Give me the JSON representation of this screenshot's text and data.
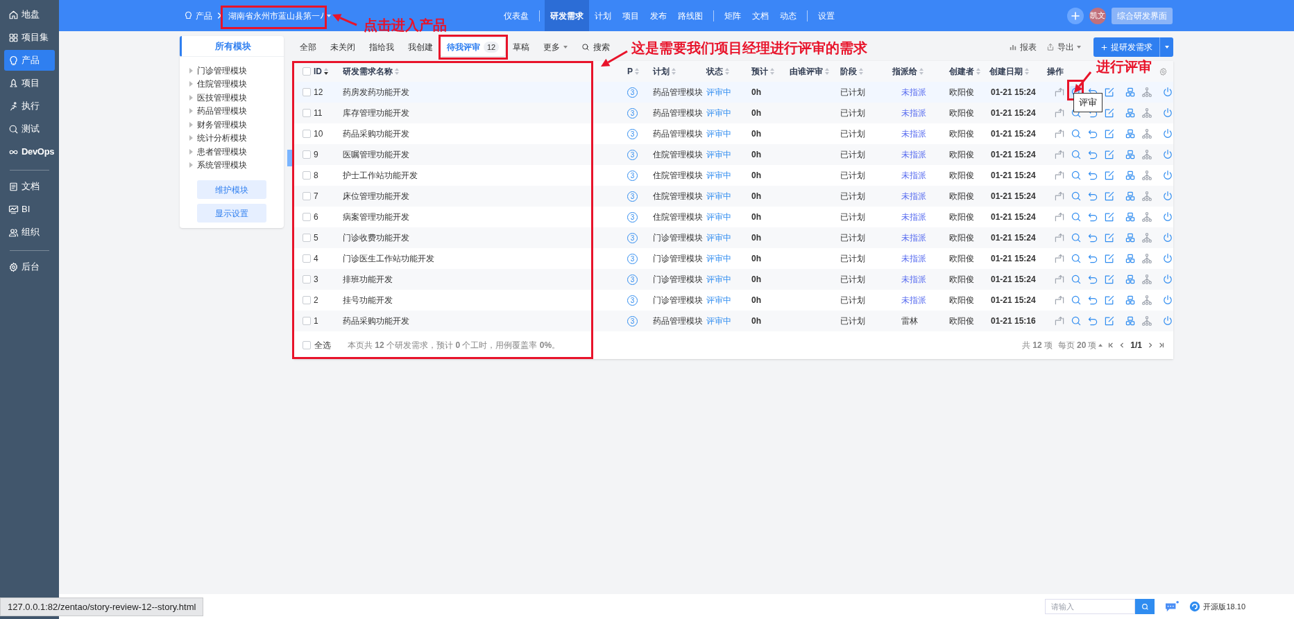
{
  "sidebar": {
    "groups": [
      [
        {
          "label": "地盘",
          "selected": false
        },
        {
          "label": "项目集",
          "selected": false
        },
        {
          "label": "产品",
          "selected": true
        },
        {
          "label": "项目",
          "selected": false
        },
        {
          "label": "执行",
          "selected": false
        },
        {
          "label": "测试",
          "selected": false
        },
        {
          "label": "DevOps",
          "selected": false
        }
      ],
      [
        {
          "label": "文档",
          "selected": false
        },
        {
          "label": "BI",
          "selected": false
        },
        {
          "label": "组织",
          "selected": false
        }
      ],
      [
        {
          "label": "后台",
          "selected": false
        }
      ]
    ]
  },
  "topbar": {
    "breadcrumb": {
      "section": "产品",
      "product": "湖南省永州市蓝山县第一ﾉ"
    },
    "nav_groups": [
      [
        {
          "label": "仪表盘",
          "selected": false
        }
      ],
      [
        {
          "label": "研发需求",
          "selected": true
        },
        {
          "label": "计划",
          "selected": false
        },
        {
          "label": "项目",
          "selected": false
        },
        {
          "label": "发布",
          "selected": false
        },
        {
          "label": "路线图",
          "selected": false
        }
      ],
      [
        {
          "label": "矩阵",
          "selected": false
        },
        {
          "label": "文档",
          "selected": false
        },
        {
          "label": "动态",
          "selected": false
        }
      ],
      [
        {
          "label": "设置",
          "selected": false
        }
      ]
    ],
    "avatar": "凯文",
    "switch_button": "综合研发界面"
  },
  "module_panel": {
    "title": "所有模块",
    "modules": [
      "门诊管理模块",
      "住院管理模块",
      "医技管理模块",
      "药品管理模块",
      "财务管理模块",
      "统计分析模块",
      "患者管理模块",
      "系统管理模块"
    ],
    "buttons": [
      "维护模块",
      "显示设置"
    ]
  },
  "tabs": [
    {
      "kind": "tab",
      "label": "全部",
      "selected": false
    },
    {
      "kind": "tab",
      "label": "未关闭",
      "selected": false
    },
    {
      "kind": "tab",
      "label": "指给我",
      "selected": false
    },
    {
      "kind": "tab",
      "label": "我创建",
      "selected": false
    },
    {
      "kind": "tab",
      "label": "待我评审",
      "count": "12",
      "selected": true
    },
    {
      "kind": "tab",
      "label": "草稿",
      "selected": false
    },
    {
      "kind": "dropdown",
      "label": "更多",
      "selected": false
    },
    {
      "kind": "search",
      "label": "搜索",
      "selected": false
    }
  ],
  "toolbar": {
    "report": "报表",
    "export": "导出",
    "create": "提研发需求"
  },
  "table": {
    "columns": [
      "ID",
      "研发需求名称",
      "P",
      "计划",
      "状态",
      "预计",
      "由谁评审",
      "阶段",
      "指派给",
      "创建者",
      "创建日期",
      "操作"
    ],
    "rows": [
      {
        "id": "12",
        "name": "药房发药功能开发",
        "p": "3",
        "plan": "药品管理模块",
        "status": "评审中",
        "estimate": "0h",
        "stage": "已计划",
        "assigned": "未指派",
        "unassigned": true,
        "creator": "欧阳俊",
        "date": "01-21 15:24",
        "checked": false,
        "hovered": true
      },
      {
        "id": "11",
        "name": "库存管理功能开发",
        "p": "3",
        "plan": "药品管理模块",
        "status": "评审中",
        "estimate": "0h",
        "stage": "已计划",
        "assigned": "未指派",
        "unassigned": true,
        "creator": "欧阳俊",
        "date": "01-21 15:24",
        "checked": false,
        "hovered": false
      },
      {
        "id": "10",
        "name": "药品采购功能开发",
        "p": "3",
        "plan": "药品管理模块",
        "status": "评审中",
        "estimate": "0h",
        "stage": "已计划",
        "assigned": "未指派",
        "unassigned": true,
        "creator": "欧阳俊",
        "date": "01-21 15:24",
        "checked": false,
        "hovered": false
      },
      {
        "id": "9",
        "name": "医嘱管理功能开发",
        "p": "3",
        "plan": "住院管理模块",
        "status": "评审中",
        "estimate": "0h",
        "stage": "已计划",
        "assigned": "未指派",
        "unassigned": true,
        "creator": "欧阳俊",
        "date": "01-21 15:24",
        "checked": false,
        "hovered": false
      },
      {
        "id": "8",
        "name": "护士工作站功能开发",
        "p": "3",
        "plan": "住院管理模块",
        "status": "评审中",
        "estimate": "0h",
        "stage": "已计划",
        "assigned": "未指派",
        "unassigned": true,
        "creator": "欧阳俊",
        "date": "01-21 15:24",
        "checked": false,
        "hovered": false
      },
      {
        "id": "7",
        "name": "床位管理功能开发",
        "p": "3",
        "plan": "住院管理模块",
        "status": "评审中",
        "estimate": "0h",
        "stage": "已计划",
        "assigned": "未指派",
        "unassigned": true,
        "creator": "欧阳俊",
        "date": "01-21 15:24",
        "checked": false,
        "hovered": false
      },
      {
        "id": "6",
        "name": "病案管理功能开发",
        "p": "3",
        "plan": "住院管理模块",
        "status": "评审中",
        "estimate": "0h",
        "stage": "已计划",
        "assigned": "未指派",
        "unassigned": true,
        "creator": "欧阳俊",
        "date": "01-21 15:24",
        "checked": false,
        "hovered": false
      },
      {
        "id": "5",
        "name": "门诊收费功能开发",
        "p": "3",
        "plan": "门诊管理模块",
        "status": "评审中",
        "estimate": "0h",
        "stage": "已计划",
        "assigned": "未指派",
        "unassigned": true,
        "creator": "欧阳俊",
        "date": "01-21 15:24",
        "checked": false,
        "hovered": false
      },
      {
        "id": "4",
        "name": "门诊医生工作站功能开发",
        "p": "3",
        "plan": "门诊管理模块",
        "status": "评审中",
        "estimate": "0h",
        "stage": "已计划",
        "assigned": "未指派",
        "unassigned": true,
        "creator": "欧阳俊",
        "date": "01-21 15:24",
        "checked": false,
        "hovered": false
      },
      {
        "id": "3",
        "name": "排班功能开发",
        "p": "3",
        "plan": "门诊管理模块",
        "status": "评审中",
        "estimate": "0h",
        "stage": "已计划",
        "assigned": "未指派",
        "unassigned": true,
        "creator": "欧阳俊",
        "date": "01-21 15:24",
        "checked": false,
        "hovered": false
      },
      {
        "id": "2",
        "name": "挂号功能开发",
        "p": "3",
        "plan": "门诊管理模块",
        "status": "评审中",
        "estimate": "0h",
        "stage": "已计划",
        "assigned": "未指派",
        "unassigned": true,
        "creator": "欧阳俊",
        "date": "01-21 15:24",
        "checked": false,
        "hovered": false
      },
      {
        "id": "1",
        "name": "药品采购功能开发",
        "p": "3",
        "plan": "药品管理模块",
        "status": "评审中",
        "estimate": "0h",
        "stage": "已计划",
        "assigned": "雷林",
        "unassigned": false,
        "creator": "欧阳俊",
        "date": "01-21 15:16",
        "checked": false,
        "hovered": false
      }
    ],
    "header_checked": false,
    "select_all": {
      "label": "全选",
      "checked": false
    },
    "summary": "本页共 **12** 个研发需求，预计 **0** 个工时，用例覆盖率 **0%**。",
    "total": "共 **12** 项",
    "per_page": "每页 **20** 项",
    "page": "1/1",
    "tooltip": "评审"
  },
  "annotations": [
    "点击进入产品",
    "这是需要我们项目经理进行评审的需求",
    "进行评审"
  ],
  "status_url": "127.0.0.1:82/zentao/story-review-12--story.html",
  "footer": {
    "search_placeholder": "请输入",
    "edition": "开源版18.10"
  }
}
